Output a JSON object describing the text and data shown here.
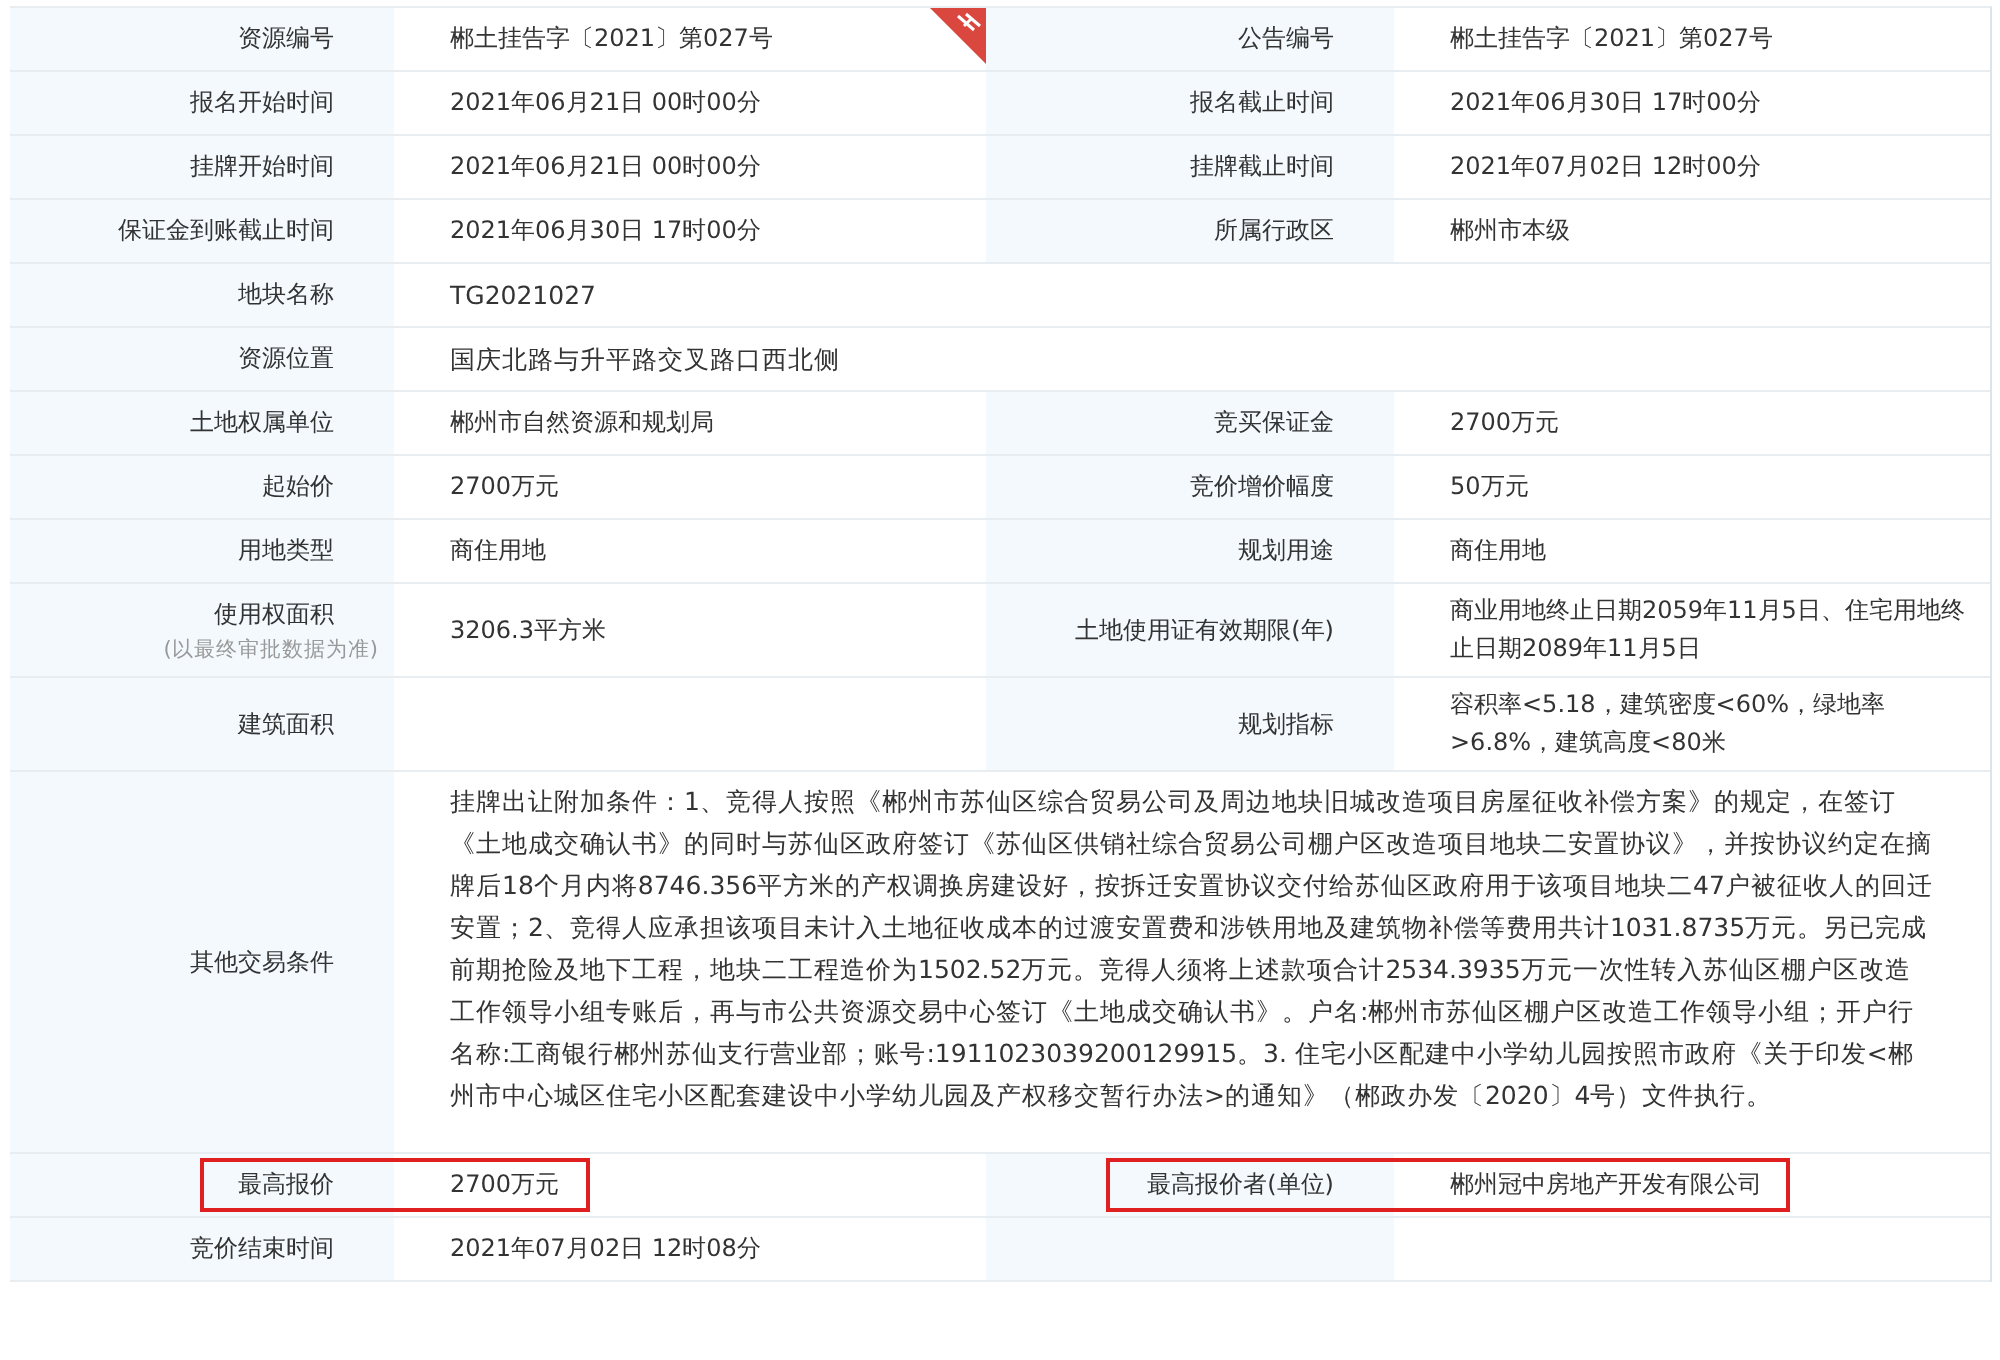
{
  "rows": [
    {
      "full": false,
      "pairs": [
        {
          "label": "资源编号",
          "value": "郴土挂告字〔2021〕第027号",
          "ribbon": true
        },
        {
          "label": "公告编号",
          "value": "郴土挂告字〔2021〕第027号"
        }
      ]
    },
    {
      "full": false,
      "pairs": [
        {
          "label": "报名开始时间",
          "value": "2021年06月21日 00时00分"
        },
        {
          "label": "报名截止时间",
          "value": "2021年06月30日 17时00分"
        }
      ]
    },
    {
      "full": false,
      "pairs": [
        {
          "label": "挂牌开始时间",
          "value": "2021年06月21日 00时00分"
        },
        {
          "label": "挂牌截止时间",
          "value": "2021年07月02日 12时00分"
        }
      ]
    },
    {
      "full": false,
      "pairs": [
        {
          "label": "保证金到账截止时间",
          "value": "2021年06月30日 17时00分"
        },
        {
          "label": "所属行政区",
          "value": "郴州市本级"
        }
      ]
    },
    {
      "full": true,
      "pairs": [
        {
          "label": "地块名称",
          "value": "TG2021027"
        }
      ]
    },
    {
      "full": true,
      "pairs": [
        {
          "label": "资源位置",
          "value": "国庆北路与升平路交叉路口西北侧"
        }
      ]
    },
    {
      "full": false,
      "pairs": [
        {
          "label": "土地权属单位",
          "value": "郴州市自然资源和规划局"
        },
        {
          "label": "竞买保证金",
          "value": "2700万元"
        }
      ]
    },
    {
      "full": false,
      "pairs": [
        {
          "label": "起始价",
          "value": "2700万元"
        },
        {
          "label": "竞价增价幅度",
          "value": "50万元"
        }
      ]
    },
    {
      "full": false,
      "pairs": [
        {
          "label": "用地类型",
          "value": "商住用地"
        },
        {
          "label": "规划用途",
          "value": "商住用地"
        }
      ]
    },
    {
      "full": false,
      "pairs": [
        {
          "label": "使用权面积",
          "note": "(以最终审批数据为准)",
          "value": "3206.3平方米"
        },
        {
          "label": "土地使用证有效期限(年)",
          "value": "商业用地终止日期2059年11月5日、住宅用地终止日期2089年11月5日"
        }
      ]
    },
    {
      "full": false,
      "pairs": [
        {
          "label": "建筑面积"
        },
        {
          "label": "规划指标",
          "value": "容积率<5.18，建筑密度<60%，绿地率>6.8%，建筑高度<80米"
        }
      ]
    },
    {
      "full": true,
      "pairs": [
        {
          "label": "其他交易条件",
          "value": "挂牌出让附加条件：1、竞得人按照《郴州市苏仙区综合贸易公司及周边地块旧城改造项目房屋征收补偿方案》的规定，在签订《土地成交确认书》的同时与苏仙区政府签订《苏仙区供销社综合贸易公司棚户区改造项目地块二安置协议》，并按协议约定在摘牌后18个月内将8746.356平方米的产权调换房建设好，按拆迁安置协议交付给苏仙区政府用于该项目地块二47户被征收人的回迁安置；2、竞得人应承担该项目未计入土地征收成本的过渡安置费和涉铁用地及建筑物补偿等费用共计1031.8735万元。另已完成前期抢险及地下工程，地块二工程造价为1502.52万元。竞得人须将上述款项合计2534.3935万元一次性转入苏仙区棚户区改造工作领导小组专账后，再与市公共资源交易中心签订《土地成交确认书》。户名:郴州市苏仙区棚户区改造工作领导小组；开户行名称:工商银行郴州苏仙支行营业部；账号:191102303920012​9915。3. 住宅小区配建中小学幼儿园按照市政府《关于印发<郴州市中心城区住宅小区配套建设中小学幼儿园及产权移交暂行办法>的通知》（郴政办发〔2020〕4号）文件执行。"
        }
      ]
    },
    {
      "full": false,
      "pairs": [
        {
          "label": "最高报价",
          "value": "2700万元",
          "highlighted": true
        },
        {
          "label": "最高报价者(单位)",
          "value": "郴州冠中房地产开发有限公司",
          "highlighted": true
        }
      ]
    },
    {
      "full": false,
      "pairs": [
        {
          "label": "竞价结束时间",
          "value": "2021年07月02日 12时08分"
        }
      ]
    }
  ]
}
